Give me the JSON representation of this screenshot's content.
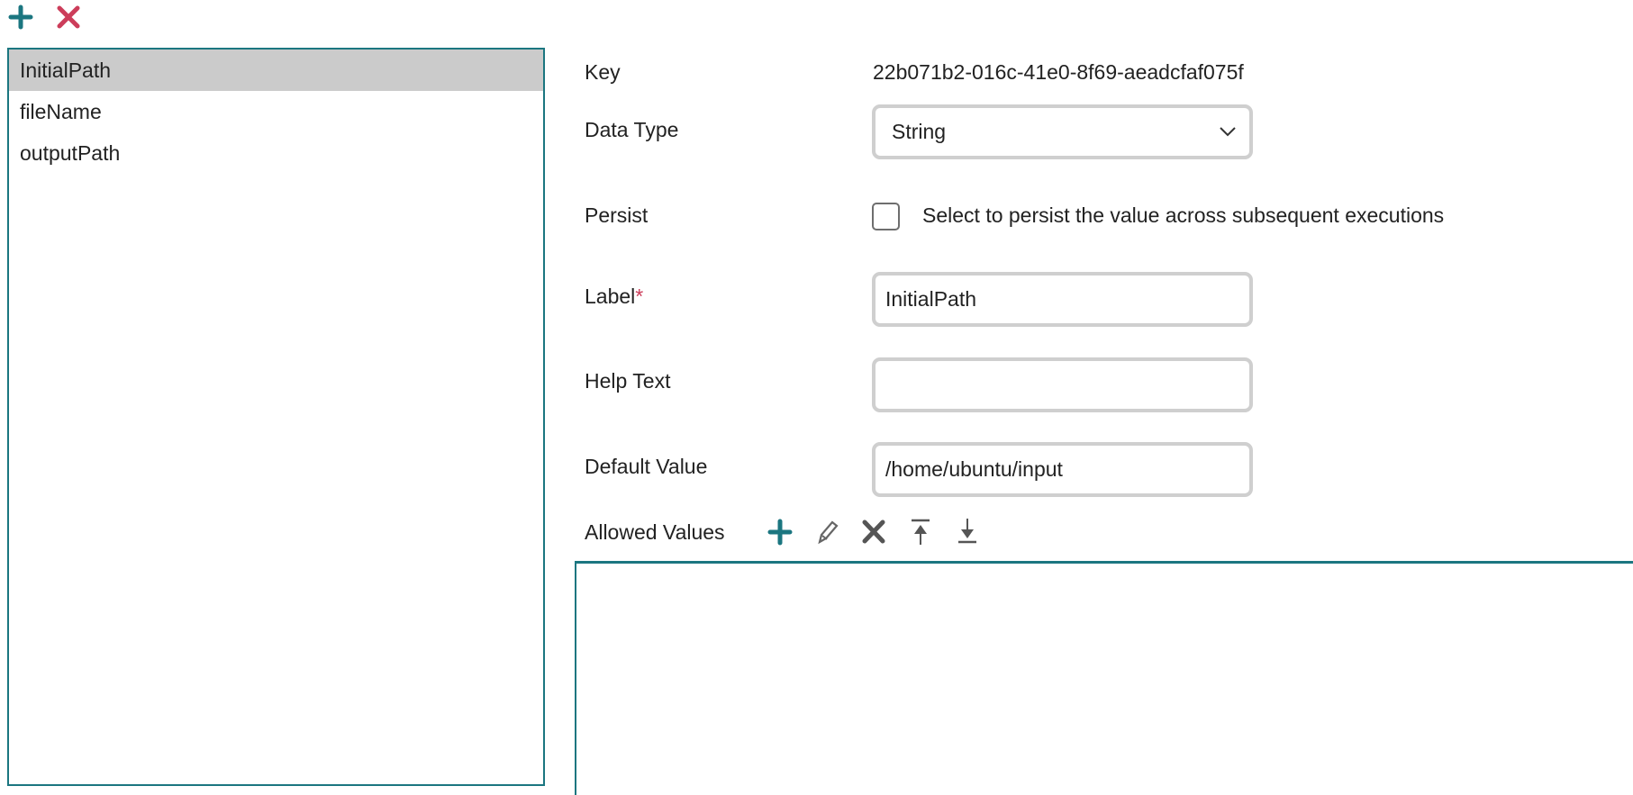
{
  "toolbar": {
    "add_icon": "plus-icon",
    "delete_icon": "close-icon",
    "add_color": "#1b7680",
    "delete_color": "#cc3d5a"
  },
  "variables": [
    {
      "label": "InitialPath",
      "selected": true
    },
    {
      "label": "fileName",
      "selected": false
    },
    {
      "label": "outputPath",
      "selected": false
    }
  ],
  "form": {
    "key_label": "Key",
    "key_value": "22b071b2-016c-41e0-8f69-aeadcfaf075f",
    "data_type_label": "Data Type",
    "data_type_value": "String",
    "persist_label": "Persist",
    "persist_checked": false,
    "persist_description": "Select to persist the value across subsequent executions",
    "label_label": "Label",
    "required_mark": "*",
    "label_value": "InitialPath",
    "help_text_label": "Help Text",
    "help_text_value": "",
    "default_value_label": "Default Value",
    "default_value": "/home/ubuntu/input",
    "allowed_values_label": "Allowed Values",
    "allowed_values": []
  }
}
